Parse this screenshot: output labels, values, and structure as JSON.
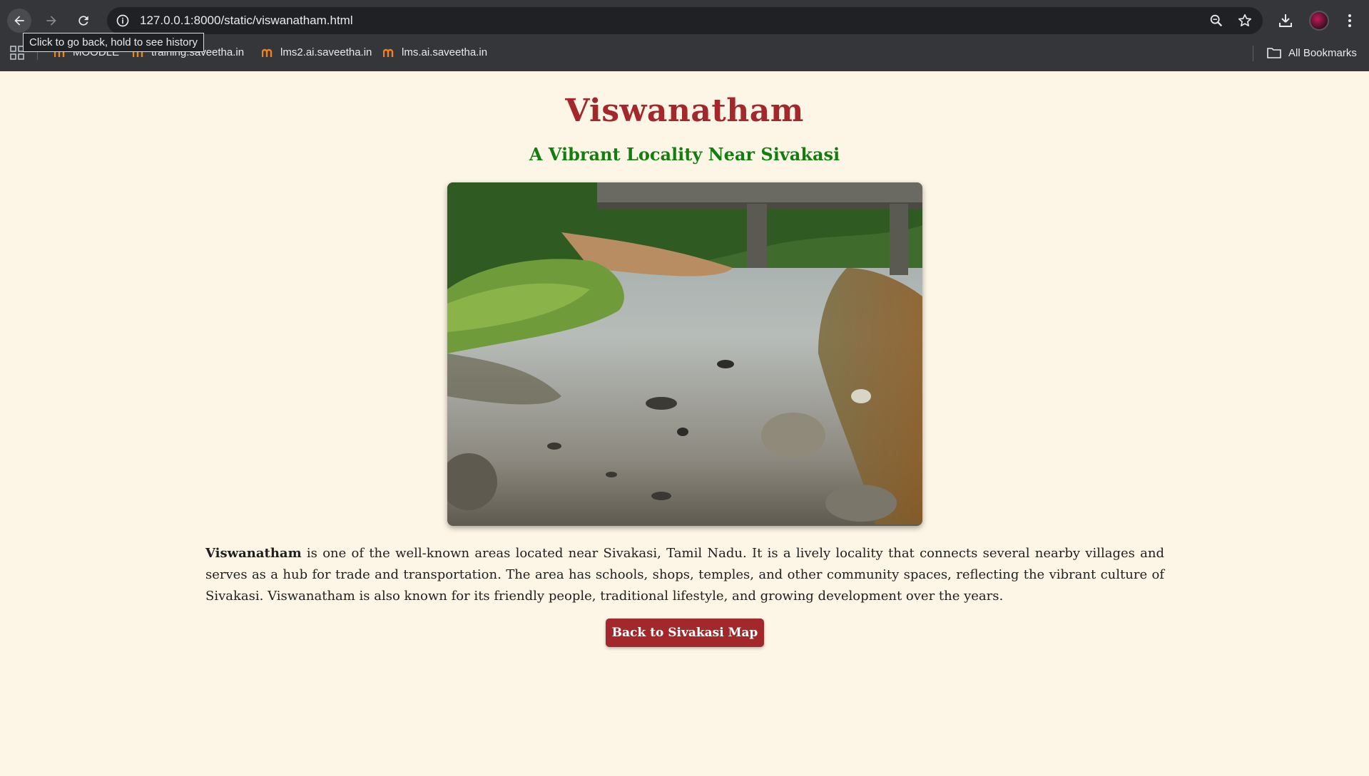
{
  "browser": {
    "url": "127.0.0.1:8000/static/viswanatham.html",
    "tooltip": "Click to go back, hold to see history",
    "bookmarks": [
      {
        "label": "MOODLE"
      },
      {
        "label": "training.saveetha.in"
      },
      {
        "label": "lms2.ai.saveetha.in"
      },
      {
        "label": "lms.ai.saveetha.in"
      }
    ],
    "all_bookmarks_label": "All Bookmarks"
  },
  "page": {
    "title": "Viswanatham",
    "subtitle": "A Vibrant Locality Near Sivakasi",
    "description_lead": "Viswanatham",
    "description_rest": " is one of the well-known areas located near Sivakasi, Tamil Nadu. It is a lively locality that connects several nearby villages and serves as a hub for trade and transportation. The area has schools, shops, temples, and other community spaces, reflecting the vibrant culture of Sivakasi. Viswanatham is also known for its friendly people, traditional lifestyle, and growing development over the years.",
    "back_button_label": "Back to Sivakasi Map"
  },
  "colors": {
    "page_background": "#fdf6e6",
    "title": "#a3282b",
    "subtitle": "#137e10",
    "button": "#a3282b"
  }
}
